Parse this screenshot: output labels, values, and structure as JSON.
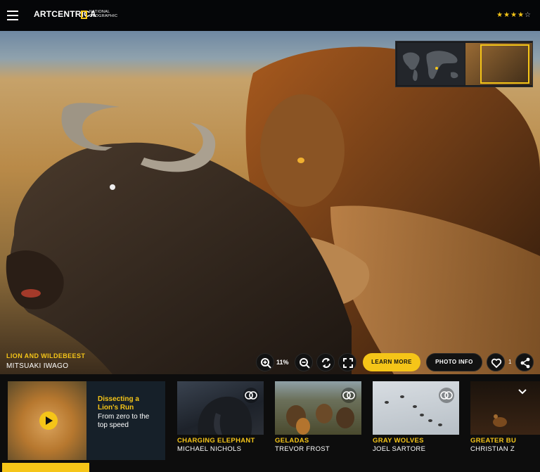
{
  "header": {
    "brand": "ARTCENTRICA",
    "partner_line1": "NATIONAL",
    "partner_line2": "GEOGRAPHIC",
    "rating": 4,
    "rating_max": 5,
    "stars_filled": "★★★★",
    "stars_empty": "☆"
  },
  "photo": {
    "title": "LION AND WILDEBEEST",
    "author": "MITSUAKI IWAGO"
  },
  "controls": {
    "zoom_level": "11%",
    "learn_more": "LEARN MORE",
    "photo_info": "PHOTO INFO",
    "like_count": "1"
  },
  "feature": {
    "title_line1": "Dissecting a",
    "title_line2": "Lion's Run",
    "subtitle": "From zero to the top speed"
  },
  "related": [
    {
      "title": "CHARGING ELEPHANT",
      "author": "MICHAEL NICHOLS"
    },
    {
      "title": "GELADAS",
      "author": "TREVOR FROST"
    },
    {
      "title": "GRAY WOLVES",
      "author": "JOEL SARTORE"
    },
    {
      "title": "GREATER BU",
      "author": "CHRISTIAN Z"
    }
  ],
  "colors": {
    "accent": "#f5c518",
    "background": "#0b0b0b"
  }
}
